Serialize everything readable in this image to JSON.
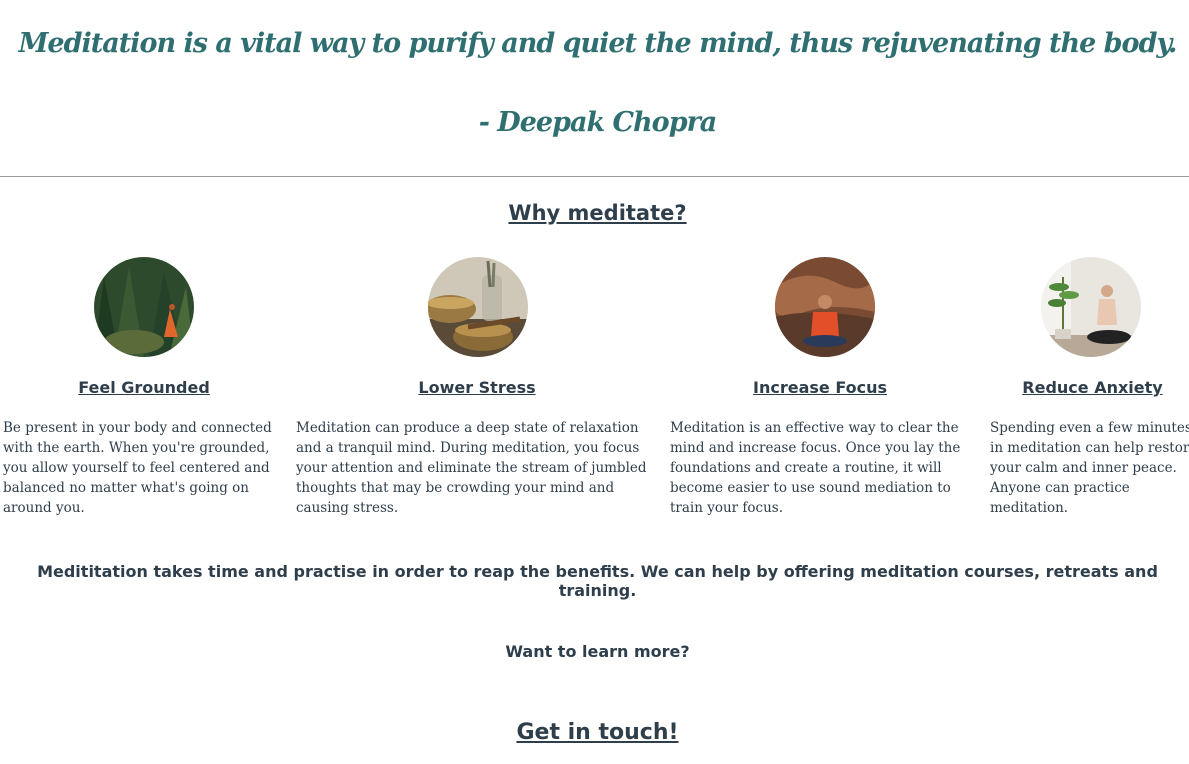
{
  "quote": {
    "text": "Meditation is a vital way to purify and quiet the mind, thus rejuvenating the body.",
    "author": "- Deepak Chopra"
  },
  "why": {
    "title": "Why meditate?"
  },
  "benefits": [
    {
      "title": "Feel Grounded",
      "text": "Be present in your body and connected with the earth. When you're grounded, you allow yourself to feel centered and balanced no matter what's going on around you."
    },
    {
      "title": "Lower Stress",
      "text": "Meditation can produce a deep state of relaxation and a tranquil mind. During meditation, you focus your attention and eliminate the stream of jumbled thoughts that may be crowding your mind and causing stress."
    },
    {
      "title": "Increase Focus",
      "text": "Meditation is an effective way to clear the mind and increase focus. Once you lay the foundations and create a routine, it will become easier to use sound mediation to train your focus."
    },
    {
      "title": "Reduce Anxiety",
      "lines": [
        "Spending even a few minutes",
        "in meditation can help restore",
        "your calm and inner peace.",
        "Anyone can practice",
        "meditation."
      ]
    }
  ],
  "notes": {
    "benefits_note": "Medititation takes time and practise in order to reap the benefits. We can help by offering meditation courses, retreats and training.",
    "learn_more": "Want to learn more?"
  },
  "contact": {
    "label": "Get in touch!"
  },
  "colors": {
    "quote": "#2f6f72",
    "text": "#2f3e4b",
    "divider": "#9a9a9a"
  }
}
